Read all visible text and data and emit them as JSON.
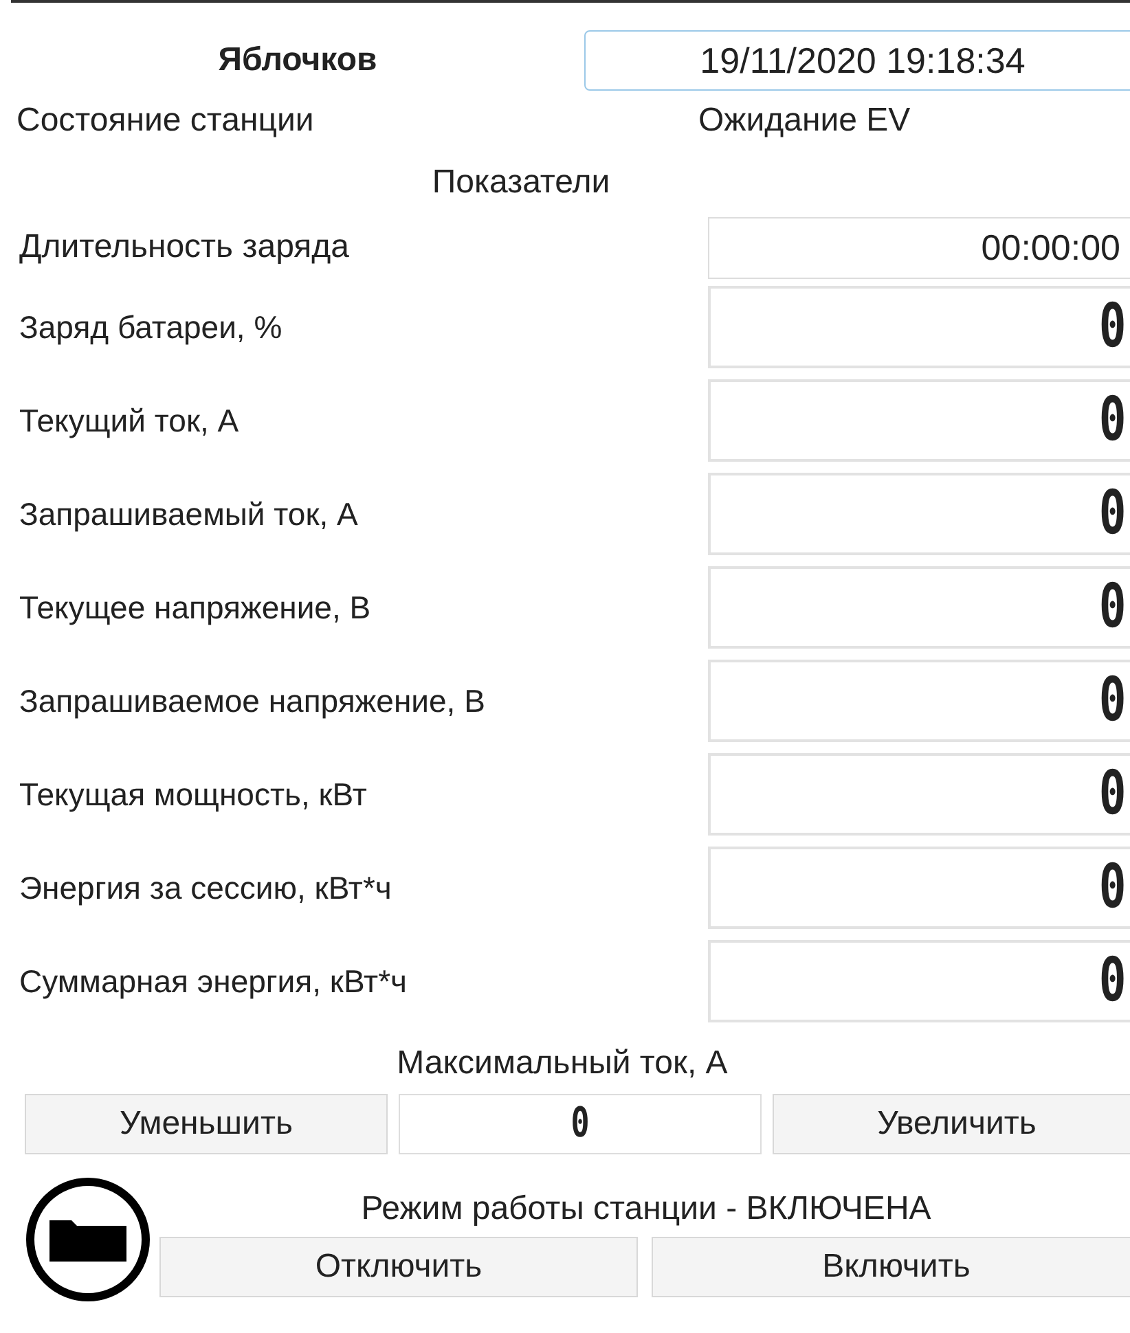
{
  "header": {
    "user": "Яблочков",
    "datetime": "19/11/2020 19:18:34"
  },
  "station_state": {
    "label": "Состояние станции",
    "value": "Ожидание EV"
  },
  "section_title": "Показатели",
  "duration": {
    "label": "Длительность заряда",
    "value": "00:00:00"
  },
  "metrics": [
    {
      "label": "Заряд батареи, %",
      "value": "0"
    },
    {
      "label": "Текущий ток, А",
      "value": "0"
    },
    {
      "label": "Запрашиваемый ток, А",
      "value": "0"
    },
    {
      "label": "Текущее напряжение, В",
      "value": "0"
    },
    {
      "label": "Запрашиваемое напряжение, В",
      "value": "0"
    },
    {
      "label": "Текущая мощность, кВт",
      "value": "0"
    },
    {
      "label": "Энергия за сессию, кВт*ч",
      "value": "0"
    },
    {
      "label": "Суммарная энергия, кВт*ч",
      "value": "0"
    }
  ],
  "max_current": {
    "label": "Максимальный ток, А",
    "decrease": "Уменьшить",
    "value": "0",
    "increase": "Увеличить"
  },
  "mode": {
    "text": "Режим работы станции - ВКЛЮЧЕНА",
    "off_button": "Отключить",
    "on_button": "Включить"
  }
}
